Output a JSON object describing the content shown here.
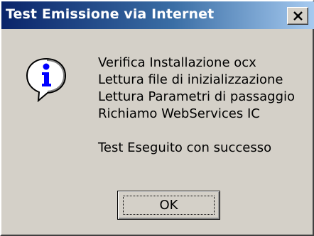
{
  "window": {
    "title": "Test Emissione via Internet",
    "close_icon": "close-icon"
  },
  "dialog": {
    "icon": "information-icon",
    "lines": [
      "Verifica Installazione ocx",
      "Lettura file di inizializzazione",
      "Lettura Parametri di passaggio",
      "Richiamo WebServices IC"
    ],
    "result": "Test Eseguito con successo"
  },
  "buttons": {
    "ok_label": "OK"
  }
}
